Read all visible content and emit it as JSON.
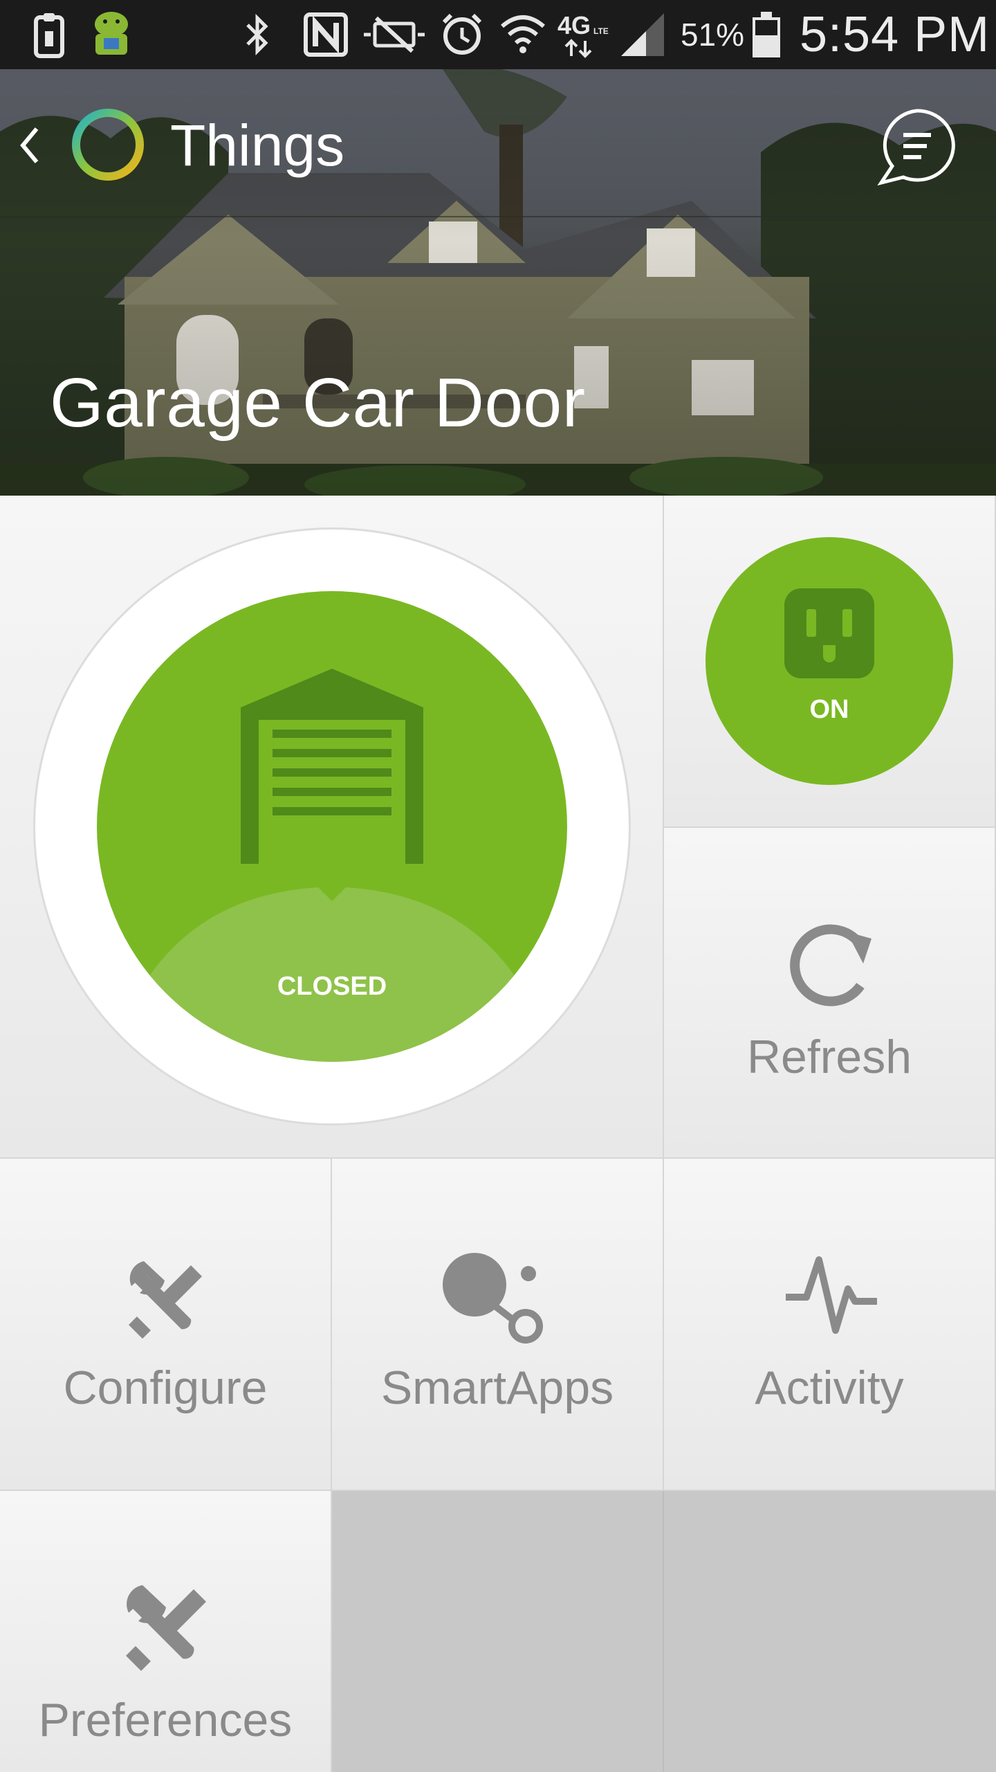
{
  "status_bar": {
    "battery_percent": "51%",
    "time": "5:54 PM",
    "icons": [
      "clipboard-icon",
      "android-icon",
      "bluetooth-icon",
      "nfc-icon",
      "mute-icon",
      "alarm-icon",
      "wifi-icon",
      "4g-lte-icon",
      "signal-icon",
      "battery-icon"
    ]
  },
  "header": {
    "title": "Things",
    "device_name": "Garage Car Door"
  },
  "main_tile": {
    "status": "CLOSED"
  },
  "switch_tile": {
    "state": "ON"
  },
  "tiles": {
    "refresh": "Refresh",
    "configure": "Configure",
    "smartapps": "SmartApps",
    "activity": "Activity",
    "preferences": "Preferences"
  },
  "colors": {
    "accent_green": "#79b823",
    "dark_green": "#4f8a1a",
    "tile_label_gray": "#8a8a8a",
    "empty_tile_gray": "#c8c8c8"
  }
}
